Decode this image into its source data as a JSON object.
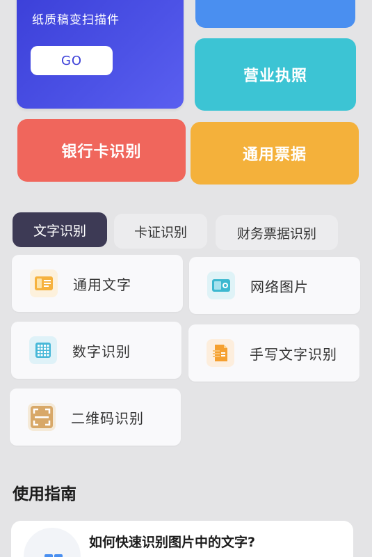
{
  "hero": {
    "scan_card": {
      "subtitle": "纸质稿变扫描件",
      "go_label": "GO"
    },
    "license_label": "营业执照",
    "bank_label": "银行卡识别",
    "receipt_label": "通用票据"
  },
  "tabs": [
    {
      "label": "文字识别",
      "active": true
    },
    {
      "label": "卡证识别",
      "active": false
    },
    {
      "label": "财务票据识别",
      "active": false
    }
  ],
  "features": [
    {
      "label": "通用文字",
      "icon": "text-document-icon",
      "color": "#f6b23e"
    },
    {
      "label": "网络图片",
      "icon": "web-image-icon",
      "color": "#3cb8d0"
    },
    {
      "label": "数字识别",
      "icon": "number-grid-icon",
      "color": "#48b8d8"
    },
    {
      "label": "手写文字识别",
      "icon": "handwriting-icon",
      "color": "#f5a030"
    },
    {
      "label": "二维码识别",
      "icon": "qr-scan-icon",
      "color": "#d8a868"
    }
  ],
  "guide": {
    "section_title": "使用指南",
    "items": [
      {
        "title": "如何快速识别图片中的文字?"
      }
    ]
  },
  "colors": {
    "scan_card": "#4c52e6",
    "license_card": "#3cc4d4",
    "bank_card": "#f0665c",
    "receipt_card": "#f4b13b",
    "active_tab": "#3d3a55"
  }
}
